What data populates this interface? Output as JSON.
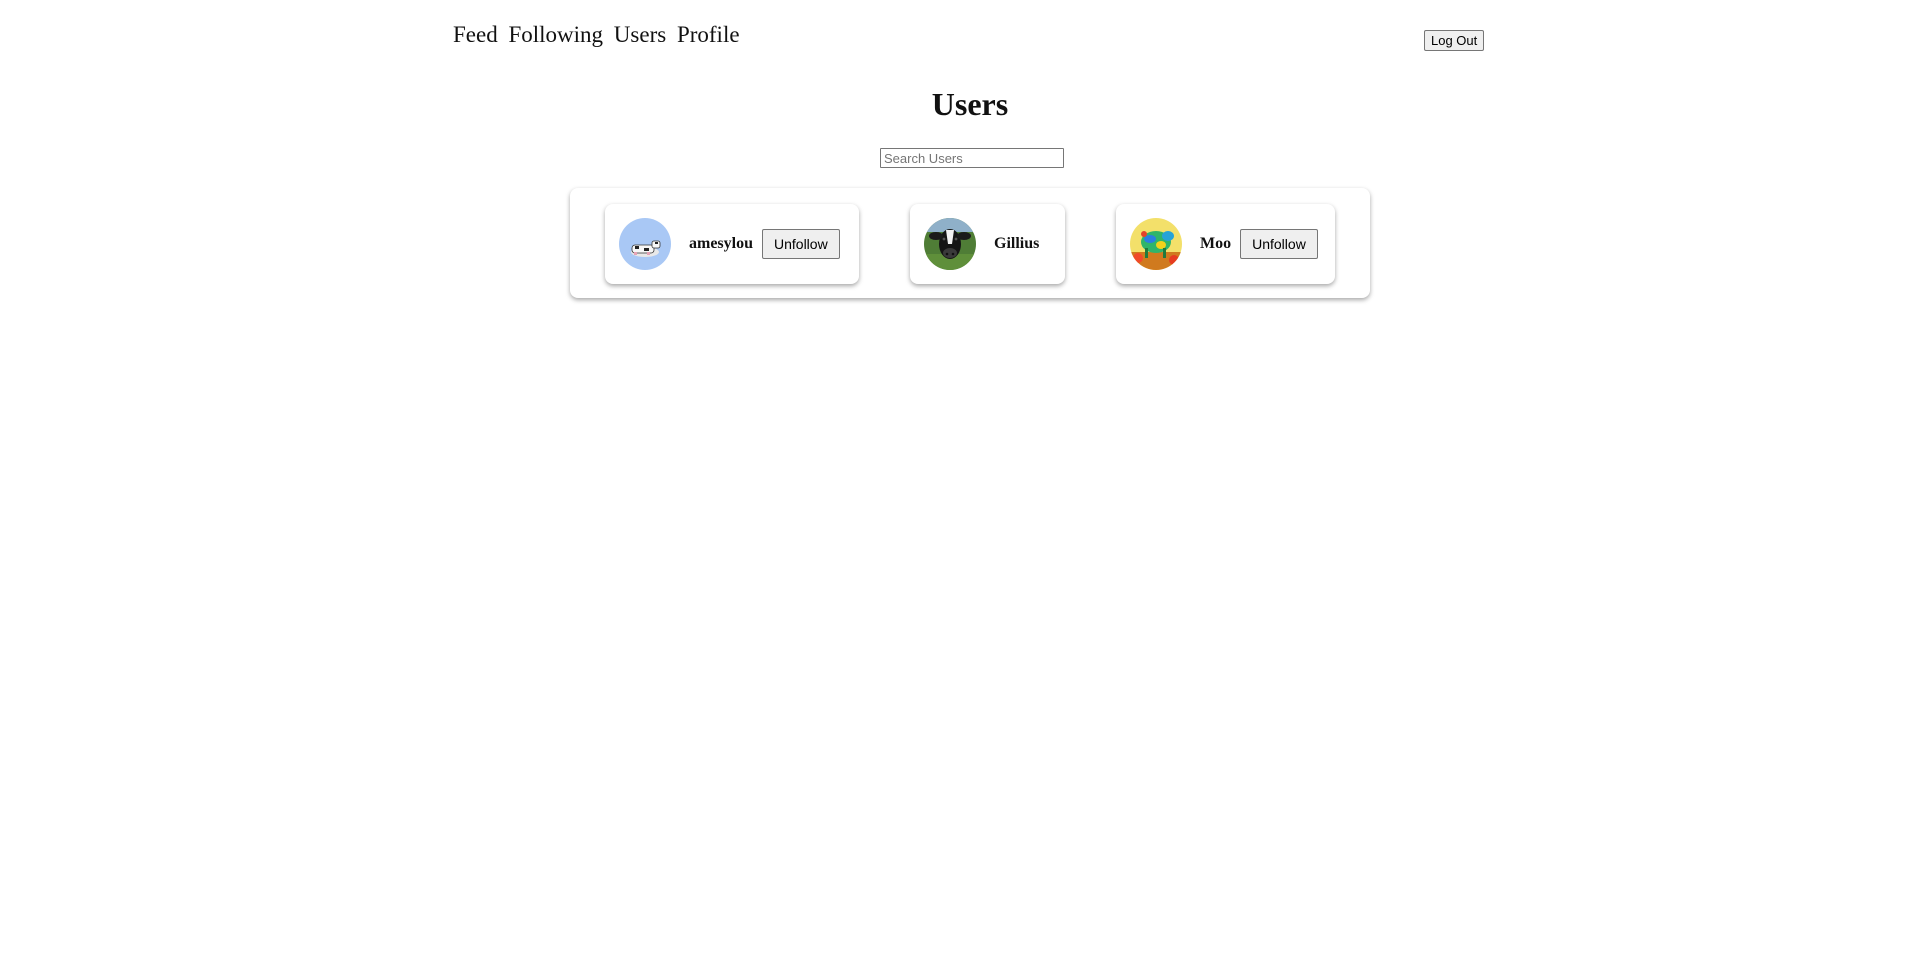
{
  "nav": {
    "items": [
      {
        "label": "Feed"
      },
      {
        "label": "Following"
      },
      {
        "label": "Users"
      },
      {
        "label": "Profile"
      }
    ],
    "logout_label": "Log Out"
  },
  "page": {
    "title": "Users"
  },
  "search": {
    "placeholder": "Search Users",
    "value": ""
  },
  "users": [
    {
      "name": "amesylou",
      "button_label": "Unfollow",
      "avatar": "cow-lying-icon"
    },
    {
      "name": "Gillius",
      "avatar": "cow-face-icon"
    },
    {
      "name": "Moo",
      "button_label": "Unfollow",
      "avatar": "colorful-cow-icon"
    }
  ]
}
